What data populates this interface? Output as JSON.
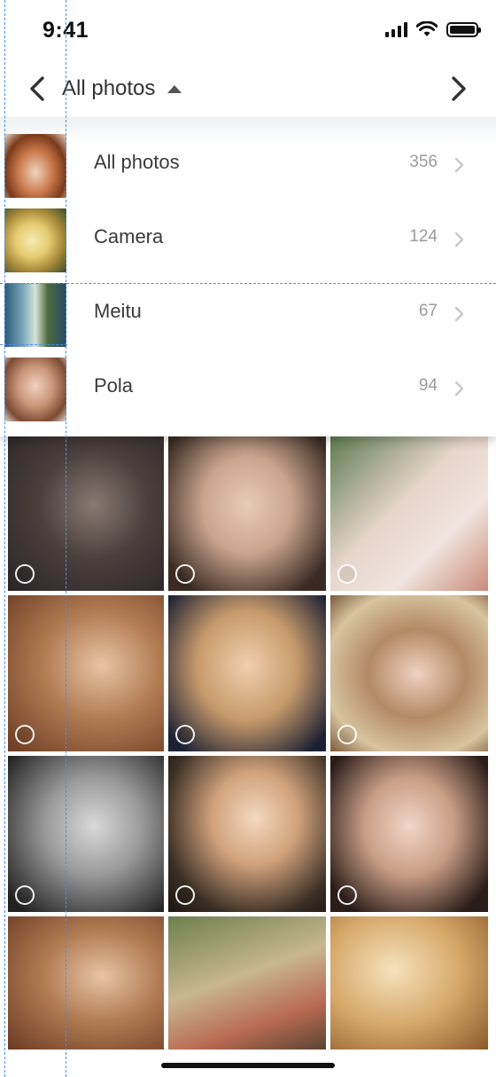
{
  "status_bar": {
    "time": "9:41",
    "icons": [
      "cellular-signal-icon",
      "wifi-icon",
      "battery-icon"
    ]
  },
  "nav": {
    "title": "All photos",
    "back_icon": "chevron-left-icon",
    "forward_icon": "chevron-right-icon",
    "dropdown_icon": "caret-up-icon"
  },
  "albums": [
    {
      "name": "All photos",
      "count": "356"
    },
    {
      "name": "Camera",
      "count": "124"
    },
    {
      "name": "Meitu",
      "count": "67"
    },
    {
      "name": "Pola",
      "count": "94"
    }
  ],
  "photos_count_visible": 12,
  "colors": {
    "accent_guide": "#4a90e2",
    "text": "#333333",
    "muted": "#9b9b9b"
  }
}
